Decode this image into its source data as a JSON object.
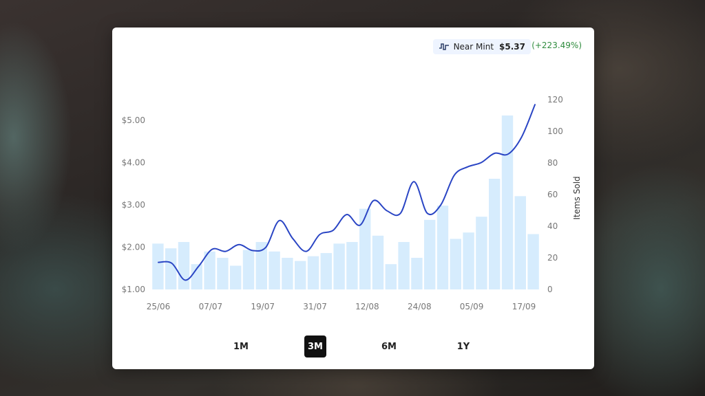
{
  "legend": {
    "label": "Near Mint",
    "price": "$5.37",
    "change": "(+223.49%)",
    "change_color": "#2e8b3d",
    "icon": "line-chart-icon"
  },
  "ranges": [
    {
      "label": "1M",
      "active": false
    },
    {
      "label": "3M",
      "active": true
    },
    {
      "label": "6M",
      "active": false
    },
    {
      "label": "1Y",
      "active": false
    }
  ],
  "chart_data": {
    "type": "bar",
    "x_ticks": [
      "25/06",
      "07/07",
      "19/07",
      "31/07",
      "12/08",
      "24/08",
      "05/09",
      "17/09"
    ],
    "y_left": {
      "ticks": [
        "$1.00",
        "$2.00",
        "$3.00",
        "$4.00",
        "$5.00"
      ],
      "ylim": [
        1.0,
        5.5
      ]
    },
    "y_right": {
      "label": "Items Sold",
      "ticks": [
        "0",
        "20",
        "40",
        "60",
        "80",
        "100",
        "120"
      ],
      "ylim": [
        0,
        120
      ]
    },
    "colors": {
      "bars": "#d6ecfd",
      "line": "#2a45c4"
    },
    "series": [
      {
        "name": "Items Sold",
        "axis": "right",
        "type": "bar",
        "values": [
          29,
          26,
          30,
          16,
          24,
          20,
          15,
          25,
          30,
          24,
          20,
          18,
          21,
          23,
          29,
          30,
          51,
          34,
          16,
          30,
          20,
          44,
          53,
          32,
          36,
          46,
          70,
          110,
          59,
          35
        ]
      },
      {
        "name": "Near Mint",
        "axis": "left",
        "type": "line",
        "values": [
          1.64,
          1.62,
          1.22,
          1.55,
          1.95,
          1.9,
          2.06,
          1.92,
          2.0,
          2.63,
          2.2,
          1.9,
          2.3,
          2.4,
          2.77,
          2.52,
          3.1,
          2.86,
          2.8,
          3.55,
          2.8,
          3.0,
          3.7,
          3.9,
          4.0,
          4.22,
          4.2,
          4.6,
          5.37
        ]
      }
    ]
  }
}
